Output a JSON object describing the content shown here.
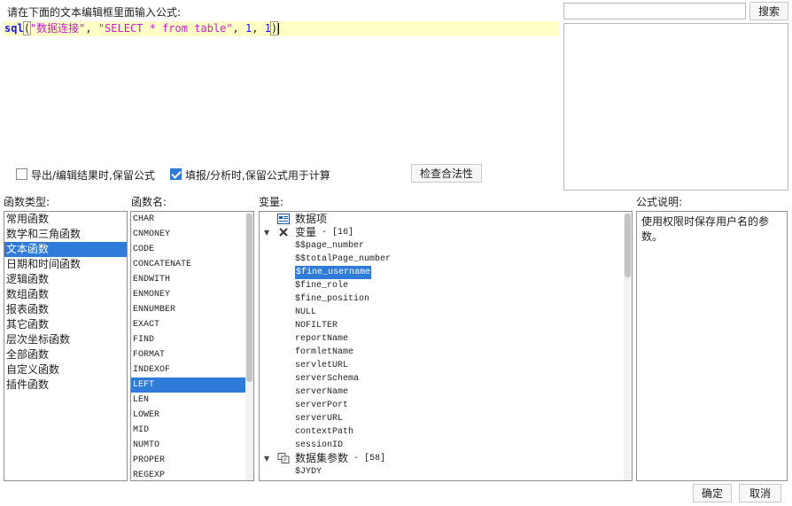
{
  "editor": {
    "label": "请在下面的文本编辑框里面输入公式:",
    "formula_func": "sql",
    "formula_open": "(",
    "formula_arg1": "\"数据连接\"",
    "formula_sep1": ", ",
    "formula_arg2": "\"SELECT * from table\"",
    "formula_sep2": ", ",
    "formula_arg3": "1",
    "formula_sep3": ", ",
    "formula_arg4": "1",
    "formula_close": ")"
  },
  "search": {
    "placeholder": "",
    "button_label": "搜索"
  },
  "options": {
    "export_keep_label": "导出/编辑结果时,保留公式",
    "export_keep_checked": false,
    "fill_keep_label": "填报/分析时,保留公式用于计算",
    "fill_keep_checked": true,
    "validate_label": "检查合法性"
  },
  "categories": {
    "title": "函数类型:",
    "items": [
      "常用函数",
      "数学和三角函数",
      "文本函数",
      "日期和时间函数",
      "逻辑函数",
      "数组函数",
      "报表函数",
      "其它函数",
      "层次坐标函数",
      "全部函数",
      "自定义函数",
      "插件函数"
    ],
    "selected": "文本函数"
  },
  "functions": {
    "title": "函数名:",
    "items": [
      "CHAR",
      "CNMONEY",
      "CODE",
      "CONCATENATE",
      "ENDWITH",
      "ENMONEY",
      "ENNUMBER",
      "EXACT",
      "FIND",
      "FORMAT",
      "INDEXOF",
      "LEFT",
      "LEN",
      "LOWER",
      "MID",
      "NUMTO",
      "PROPER",
      "REGEXP"
    ],
    "selected": "LEFT"
  },
  "variables": {
    "title": "变量:",
    "data_item_label": "数据项",
    "var_group_label": "变量",
    "var_group_count": "- [16]",
    "var_items": [
      "$$page_number",
      "$$totalPage_number",
      "$fine_username",
      "$fine_role",
      "$fine_position",
      "NULL",
      "NOFILTER",
      "reportName",
      "formletName",
      "servletURL",
      "serverSchema",
      "serverName",
      "serverPort",
      "serverURL",
      "contextPath",
      "sessionID"
    ],
    "selected": "$fine_username",
    "dataset_group_label": "数据集参数",
    "dataset_group_count": "- [58]",
    "dataset_items": [
      "$JYDY"
    ]
  },
  "description": {
    "title": "公式说明:",
    "text": "使用权限时保存用户名的参数。"
  },
  "footer": {
    "ok_label": "确定",
    "cancel_label": "取消"
  },
  "colors": {
    "selection": "#2f7bd9",
    "editor_line": "#ffffc6",
    "keyword": "#1a1ae0",
    "string": "#c81ec8"
  }
}
